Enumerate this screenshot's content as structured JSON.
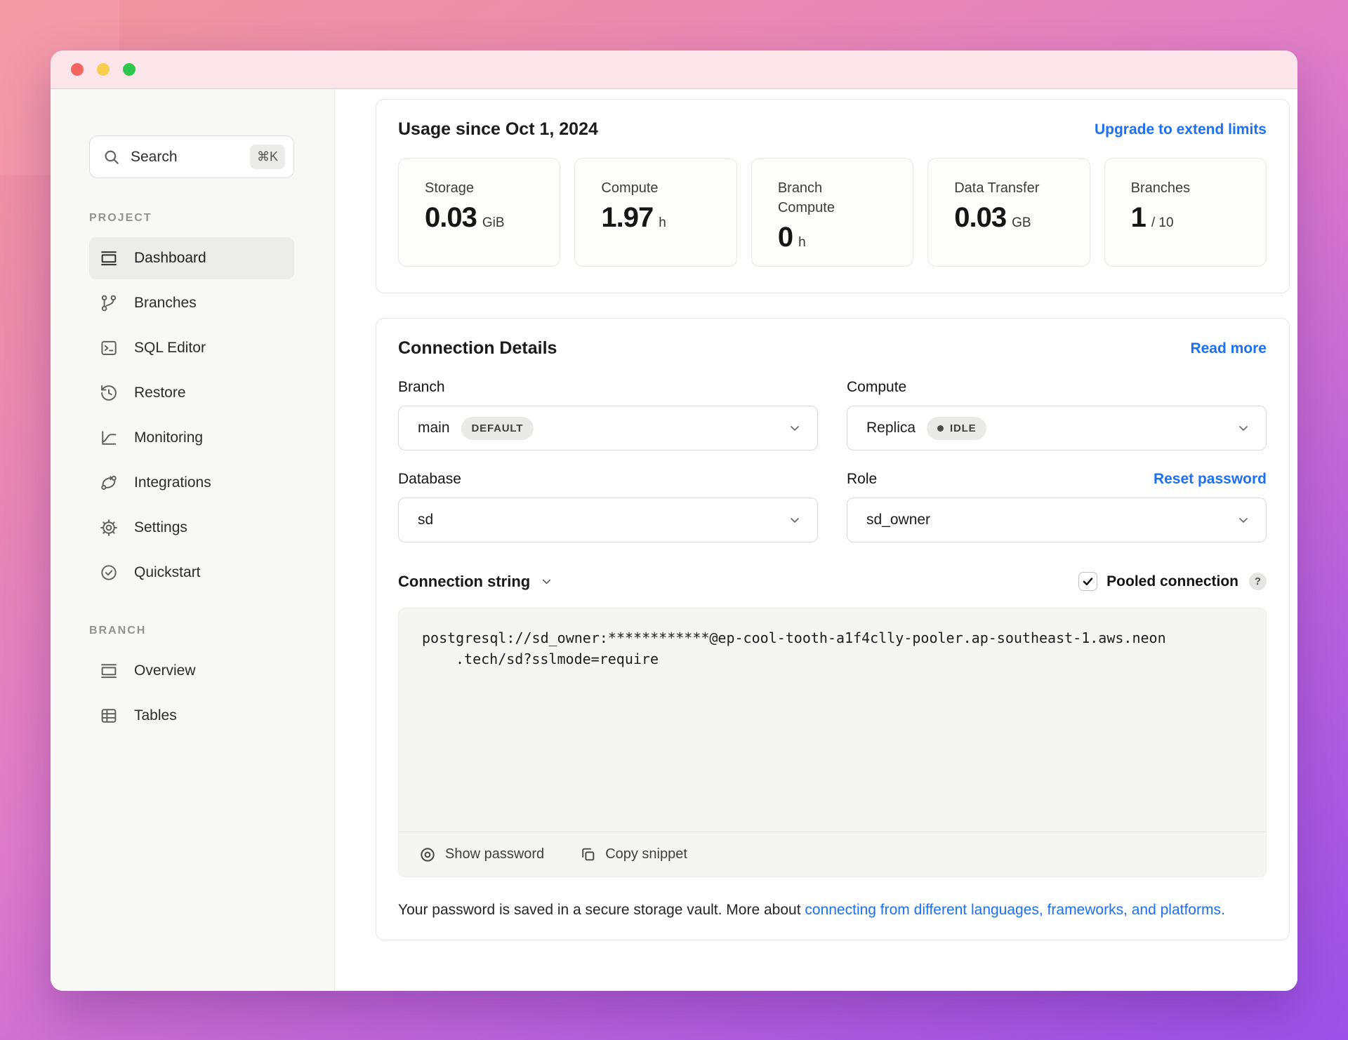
{
  "window": {
    "traffic_lights": {
      "close": "#f46560",
      "minimize": "#f5ce4e",
      "zoom": "#2fc84c"
    }
  },
  "colors": {
    "accent_blue": "#1d6ff5",
    "titlebar_pink": "#fbe5ea"
  },
  "sidebar": {
    "search": {
      "label": "Search",
      "shortcut": "⌘K",
      "icon": "search-icon"
    },
    "sections": [
      {
        "label": "PROJECT",
        "items": [
          {
            "label": "Dashboard",
            "icon": "dashboard-icon",
            "active": true
          },
          {
            "label": "Branches",
            "icon": "branches-icon",
            "active": false
          },
          {
            "label": "SQL Editor",
            "icon": "sql-editor-icon",
            "active": false
          },
          {
            "label": "Restore",
            "icon": "restore-icon",
            "active": false
          },
          {
            "label": "Monitoring",
            "icon": "monitoring-icon",
            "active": false
          },
          {
            "label": "Integrations",
            "icon": "integrations-icon",
            "active": false
          },
          {
            "label": "Settings",
            "icon": "settings-icon",
            "active": false
          },
          {
            "label": "Quickstart",
            "icon": "quickstart-icon",
            "active": false
          }
        ]
      },
      {
        "label": "BRANCH",
        "items": [
          {
            "label": "Overview",
            "icon": "overview-icon",
            "active": false
          },
          {
            "label": "Tables",
            "icon": "tables-icon",
            "active": false
          }
        ]
      }
    ]
  },
  "usage": {
    "title": "Usage since Oct 1, 2024",
    "upgrade_link": "Upgrade to extend limits",
    "metrics": [
      {
        "label": "Storage",
        "value": "0.03",
        "unit": "GiB"
      },
      {
        "label": "Compute",
        "value": "1.97",
        "unit": "h"
      },
      {
        "label": "Branch Compute",
        "value": "0",
        "unit": "h"
      },
      {
        "label": "Data Transfer",
        "value": "0.03",
        "unit": "GB"
      },
      {
        "label": "Branches",
        "value": "1",
        "unit": "/ 10"
      }
    ]
  },
  "connection": {
    "title": "Connection Details",
    "read_more": "Read more",
    "branch": {
      "label": "Branch",
      "value": "main",
      "badge": "DEFAULT"
    },
    "compute": {
      "label": "Compute",
      "value": "Replica",
      "badge": "IDLE"
    },
    "database": {
      "label": "Database",
      "value": "sd"
    },
    "role": {
      "label": "Role",
      "value": "sd_owner",
      "action": "Reset password"
    },
    "string_section": {
      "label": "Connection string",
      "pooled_label": "Pooled connection",
      "help_badge": "?",
      "code_line1": "postgresql://sd_owner:************@ep-cool-tooth-a1f4clly-pooler.ap-southeast-1.aws.neon",
      "code_line2": ".tech/sd?sslmode=require",
      "show_password": "Show password",
      "copy_snippet": "Copy snippet"
    },
    "footer": {
      "text": "Your password is saved in a secure storage vault. More about ",
      "link": "connecting from different languages, frameworks, and platforms."
    }
  }
}
